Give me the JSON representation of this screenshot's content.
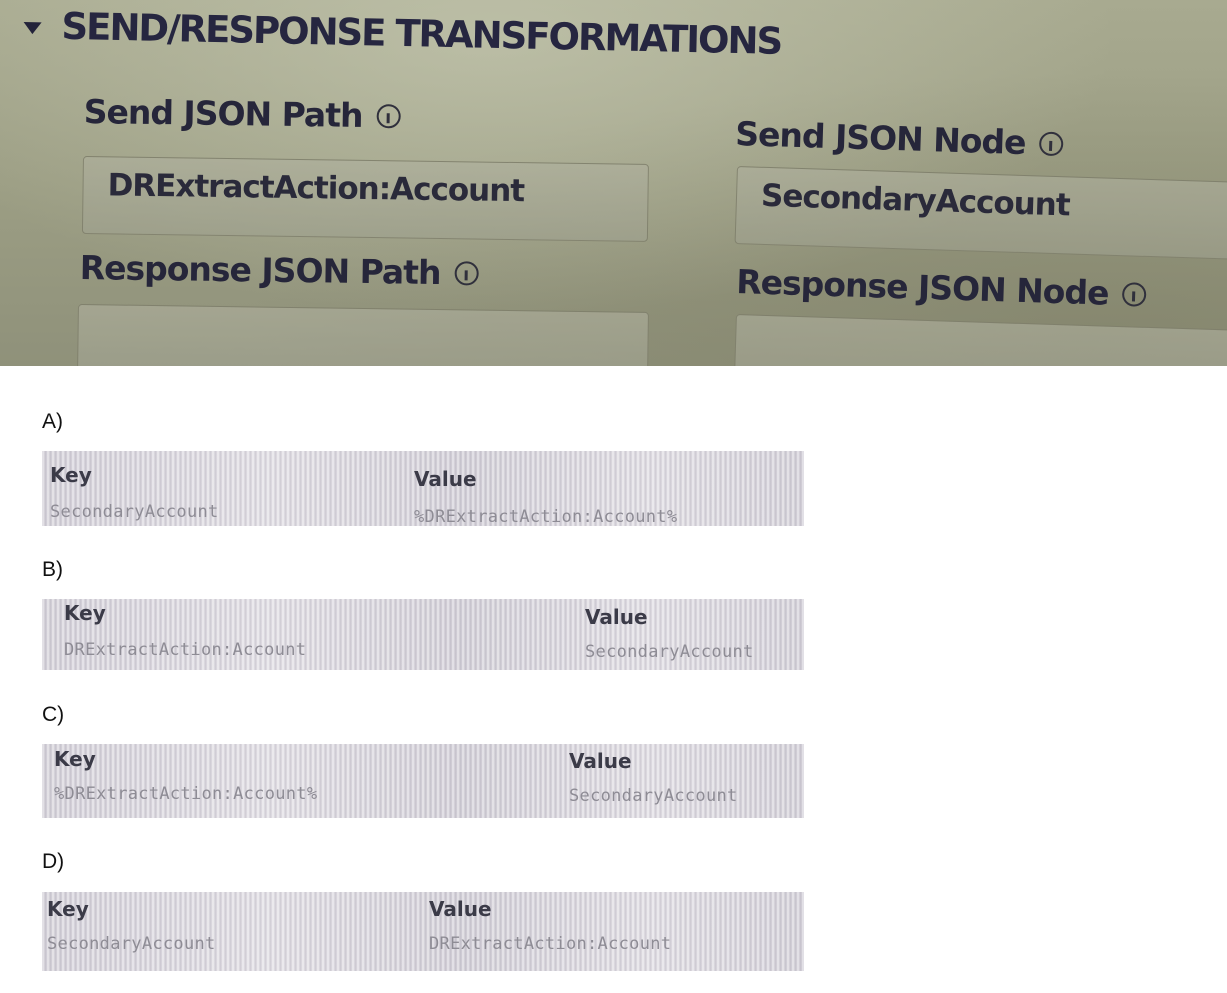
{
  "panel": {
    "section_title": "SEND/RESPONSE TRANSFORMATIONS",
    "send_json_path": {
      "label": "Send JSON Path",
      "value": "DRExtractAction:Account"
    },
    "send_json_node": {
      "label": "Send JSON Node",
      "value": "SecondaryAccount"
    },
    "response_json_path": {
      "label": "Response JSON Path",
      "value": ""
    },
    "response_json_node": {
      "label": "Response JSON Node",
      "value": ""
    }
  },
  "options": [
    {
      "letter": "A)",
      "key_header": "Key",
      "value_header": "Value",
      "key": "SecondaryAccount",
      "value": "%DRExtractAction:Account%"
    },
    {
      "letter": "B)",
      "key_header": "Key",
      "value_header": "Value",
      "key": "DRExtractAction:Account",
      "value": "SecondaryAccount"
    },
    {
      "letter": "C)",
      "key_header": "Key",
      "value_header": "Value",
      "key": "%DRExtractAction:Account%",
      "value": "SecondaryAccount"
    },
    {
      "letter": "D)",
      "key_header": "Key",
      "value_header": "Value",
      "key": "SecondaryAccount",
      "value": "DRExtractAction:Account"
    }
  ],
  "icons": {
    "collapse": "caret-down-icon",
    "info": "info-icon"
  }
}
